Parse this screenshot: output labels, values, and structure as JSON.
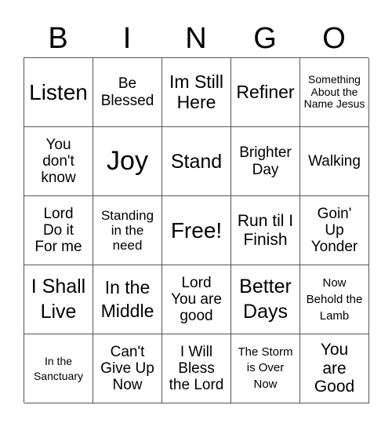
{
  "header": [
    "B",
    "I",
    "N",
    "G",
    "O"
  ],
  "cells": [
    "Listen",
    "Be Blessed",
    "Im Still Here",
    "Refiner",
    "Something About the Name Jesus",
    "You don't know",
    "Joy",
    "Stand",
    "Brighter Day",
    "Walking",
    "Lord Do it For me",
    "Standing in the need",
    "Free!",
    "Run til I Finish",
    "Goin' Up Yonder",
    "I Shall Live",
    "In the Middle",
    "Lord You are good",
    "Better Days",
    "Now Behold the Lamb",
    "In the Sanctuary",
    "Can't Give Up Now",
    "I Will Bless the Lord",
    "The Storm is Over Now",
    "You are Good"
  ]
}
